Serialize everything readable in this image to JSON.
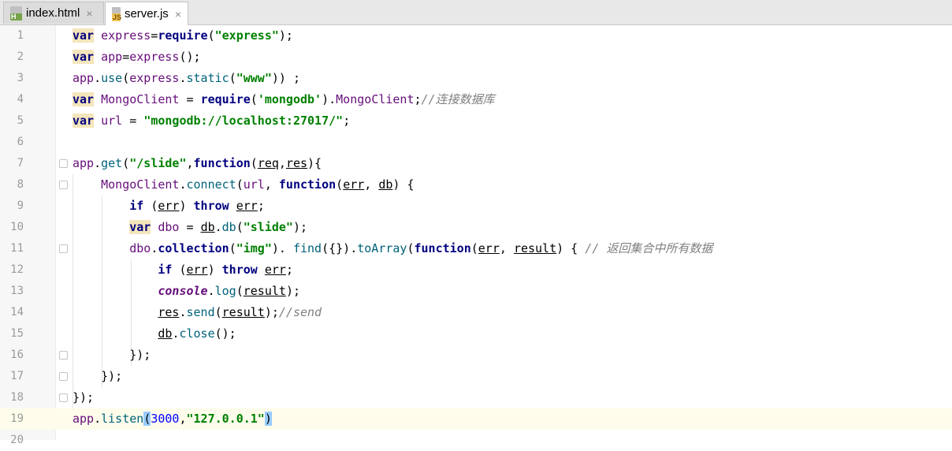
{
  "tabs": [
    {
      "name": "index.html",
      "icon": "html-file-icon",
      "icon_text": "H",
      "active": false
    },
    {
      "name": "server.js",
      "icon": "js-file-icon",
      "icon_text": "JS",
      "active": true
    }
  ],
  "close_glyph": "×",
  "current_line": 19,
  "lines": [
    {
      "n": "1",
      "t": [
        [
          "kw kwbg",
          "var"
        ],
        [
          "",
          " "
        ],
        [
          "ident",
          "express"
        ],
        [
          "",
          "="
        ],
        [
          "kw",
          "require"
        ],
        [
          "",
          "("
        ],
        [
          "str",
          "\"express\""
        ],
        [
          "",
          ");"
        ]
      ]
    },
    {
      "n": "2",
      "t": [
        [
          "kw kwbg",
          "var"
        ],
        [
          "",
          " "
        ],
        [
          "ident",
          "app"
        ],
        [
          "",
          "="
        ],
        [
          "ident",
          "express"
        ],
        [
          "",
          "();"
        ]
      ]
    },
    {
      "n": "3",
      "t": [
        [
          "ident",
          "app"
        ],
        [
          "",
          "."
        ],
        [
          "fn",
          "use"
        ],
        [
          "",
          "("
        ],
        [
          "ident",
          "express"
        ],
        [
          "",
          "."
        ],
        [
          "fn",
          "static"
        ],
        [
          "",
          "("
        ],
        [
          "str",
          "\"www\""
        ],
        [
          "",
          "))"
        ],
        [
          "",
          " ;"
        ]
      ]
    },
    {
      "n": "4",
      "t": [
        [
          "kw kwbg",
          "var"
        ],
        [
          "",
          " "
        ],
        [
          "ident",
          "MongoClient"
        ],
        [
          "",
          " = "
        ],
        [
          "kw",
          "require"
        ],
        [
          "",
          "("
        ],
        [
          "str",
          "'mongodb'"
        ],
        [
          "",
          ")."
        ],
        [
          "ident",
          "MongoClient"
        ],
        [
          "",
          ";"
        ],
        [
          "cmt",
          "//连接数据库"
        ]
      ]
    },
    {
      "n": "5",
      "t": [
        [
          "kw kwbg",
          "var"
        ],
        [
          "",
          " "
        ],
        [
          "ident",
          "url"
        ],
        [
          "",
          " = "
        ],
        [
          "str",
          "\"mongodb://localhost:27017/\""
        ],
        [
          "",
          ";"
        ]
      ]
    },
    {
      "n": "6",
      "t": []
    },
    {
      "n": "7",
      "t": [
        [
          "ident",
          "app"
        ],
        [
          "",
          "."
        ],
        [
          "fn",
          "get"
        ],
        [
          "",
          "("
        ],
        [
          "str",
          "\"/slide\""
        ],
        [
          "",
          ","
        ],
        [
          "kw",
          "function"
        ],
        [
          "",
          "("
        ],
        [
          "u",
          "req"
        ],
        [
          "",
          ","
        ],
        [
          "u",
          "res"
        ],
        [
          "",
          "){"
        ]
      ]
    },
    {
      "n": "8",
      "t": [
        [
          "",
          "    "
        ],
        [
          "ident",
          "MongoClient"
        ],
        [
          "",
          "."
        ],
        [
          "fn",
          "connect"
        ],
        [
          "",
          "("
        ],
        [
          "ident",
          "url"
        ],
        [
          ",",
          ", "
        ],
        [
          "kw",
          "function"
        ],
        [
          "",
          "("
        ],
        [
          "u",
          "err"
        ],
        [
          "",
          ", "
        ],
        [
          "u",
          "db"
        ],
        [
          "",
          ") {"
        ]
      ]
    },
    {
      "n": "9",
      "t": [
        [
          "",
          "        "
        ],
        [
          "kw",
          "if"
        ],
        [
          "",
          " ("
        ],
        [
          "u",
          "err"
        ],
        [
          "",
          ") "
        ],
        [
          "kw",
          "throw"
        ],
        [
          "",
          " "
        ],
        [
          "u",
          "err"
        ],
        [
          "",
          ";"
        ]
      ]
    },
    {
      "n": "10",
      "t": [
        [
          "",
          "        "
        ],
        [
          "kw kwbg",
          "var"
        ],
        [
          "",
          " "
        ],
        [
          "ident",
          "dbo"
        ],
        [
          "",
          " = "
        ],
        [
          "u",
          "db"
        ],
        [
          "",
          "."
        ],
        [
          "fn",
          "db"
        ],
        [
          "",
          "("
        ],
        [
          "str",
          "\"slide\""
        ],
        [
          "",
          ");"
        ]
      ]
    },
    {
      "n": "11",
      "t": [
        [
          "",
          "        "
        ],
        [
          "ident",
          "dbo"
        ],
        [
          "",
          "."
        ],
        [
          "kw",
          "collection"
        ],
        [
          "",
          "("
        ],
        [
          "str",
          "\"img\""
        ],
        [
          "",
          ")."
        ],
        [
          "",
          " "
        ],
        [
          "fn",
          "find"
        ],
        [
          "",
          "({})."
        ],
        [
          "fn",
          "toArray"
        ],
        [
          "",
          "("
        ],
        [
          "kw",
          "function"
        ],
        [
          "",
          "("
        ],
        [
          "u",
          "err"
        ],
        [
          "",
          ", "
        ],
        [
          "u",
          "result"
        ],
        [
          "",
          ") { "
        ],
        [
          "cmt",
          "// 返回集合中所有数据"
        ]
      ]
    },
    {
      "n": "12",
      "t": [
        [
          "",
          "            "
        ],
        [
          "kw",
          "if"
        ],
        [
          "",
          " ("
        ],
        [
          "u",
          "err"
        ],
        [
          "",
          ") "
        ],
        [
          "kw",
          "throw"
        ],
        [
          "",
          " "
        ],
        [
          "u",
          "err"
        ],
        [
          "",
          ";"
        ]
      ]
    },
    {
      "n": "13",
      "t": [
        [
          "",
          "            "
        ],
        [
          "glob",
          "console"
        ],
        [
          "",
          "."
        ],
        [
          "fn",
          "log"
        ],
        [
          "",
          "("
        ],
        [
          "u",
          "result"
        ],
        [
          "",
          ");"
        ]
      ]
    },
    {
      "n": "14",
      "t": [
        [
          "",
          "            "
        ],
        [
          "u",
          "res"
        ],
        [
          "",
          "."
        ],
        [
          "fn",
          "send"
        ],
        [
          "",
          "("
        ],
        [
          "u",
          "result"
        ],
        [
          "",
          ");"
        ],
        [
          "cmt",
          "//send"
        ]
      ]
    },
    {
      "n": "15",
      "t": [
        [
          "",
          "            "
        ],
        [
          "u",
          "db"
        ],
        [
          "",
          "."
        ],
        [
          "fn",
          "close"
        ],
        [
          "",
          "();"
        ]
      ]
    },
    {
      "n": "16",
      "t": [
        [
          "",
          "        "
        ],
        [
          "",
          "});"
        ]
      ]
    },
    {
      "n": "17",
      "t": [
        [
          "",
          "    "
        ],
        [
          "",
          "});"
        ]
      ]
    },
    {
      "n": "18",
      "t": [
        [
          "",
          "});"
        ]
      ]
    },
    {
      "n": "19",
      "t": [
        [
          "ident",
          "app"
        ],
        [
          "",
          "."
        ],
        [
          "fn",
          "listen"
        ],
        [
          "bracket",
          "("
        ],
        [
          "num",
          "3000"
        ],
        [
          "",
          ","
        ],
        [
          "str",
          "\"127.0.0.1\""
        ],
        [
          "bracket",
          ")"
        ]
      ]
    },
    {
      "n": "20",
      "t": []
    }
  ]
}
